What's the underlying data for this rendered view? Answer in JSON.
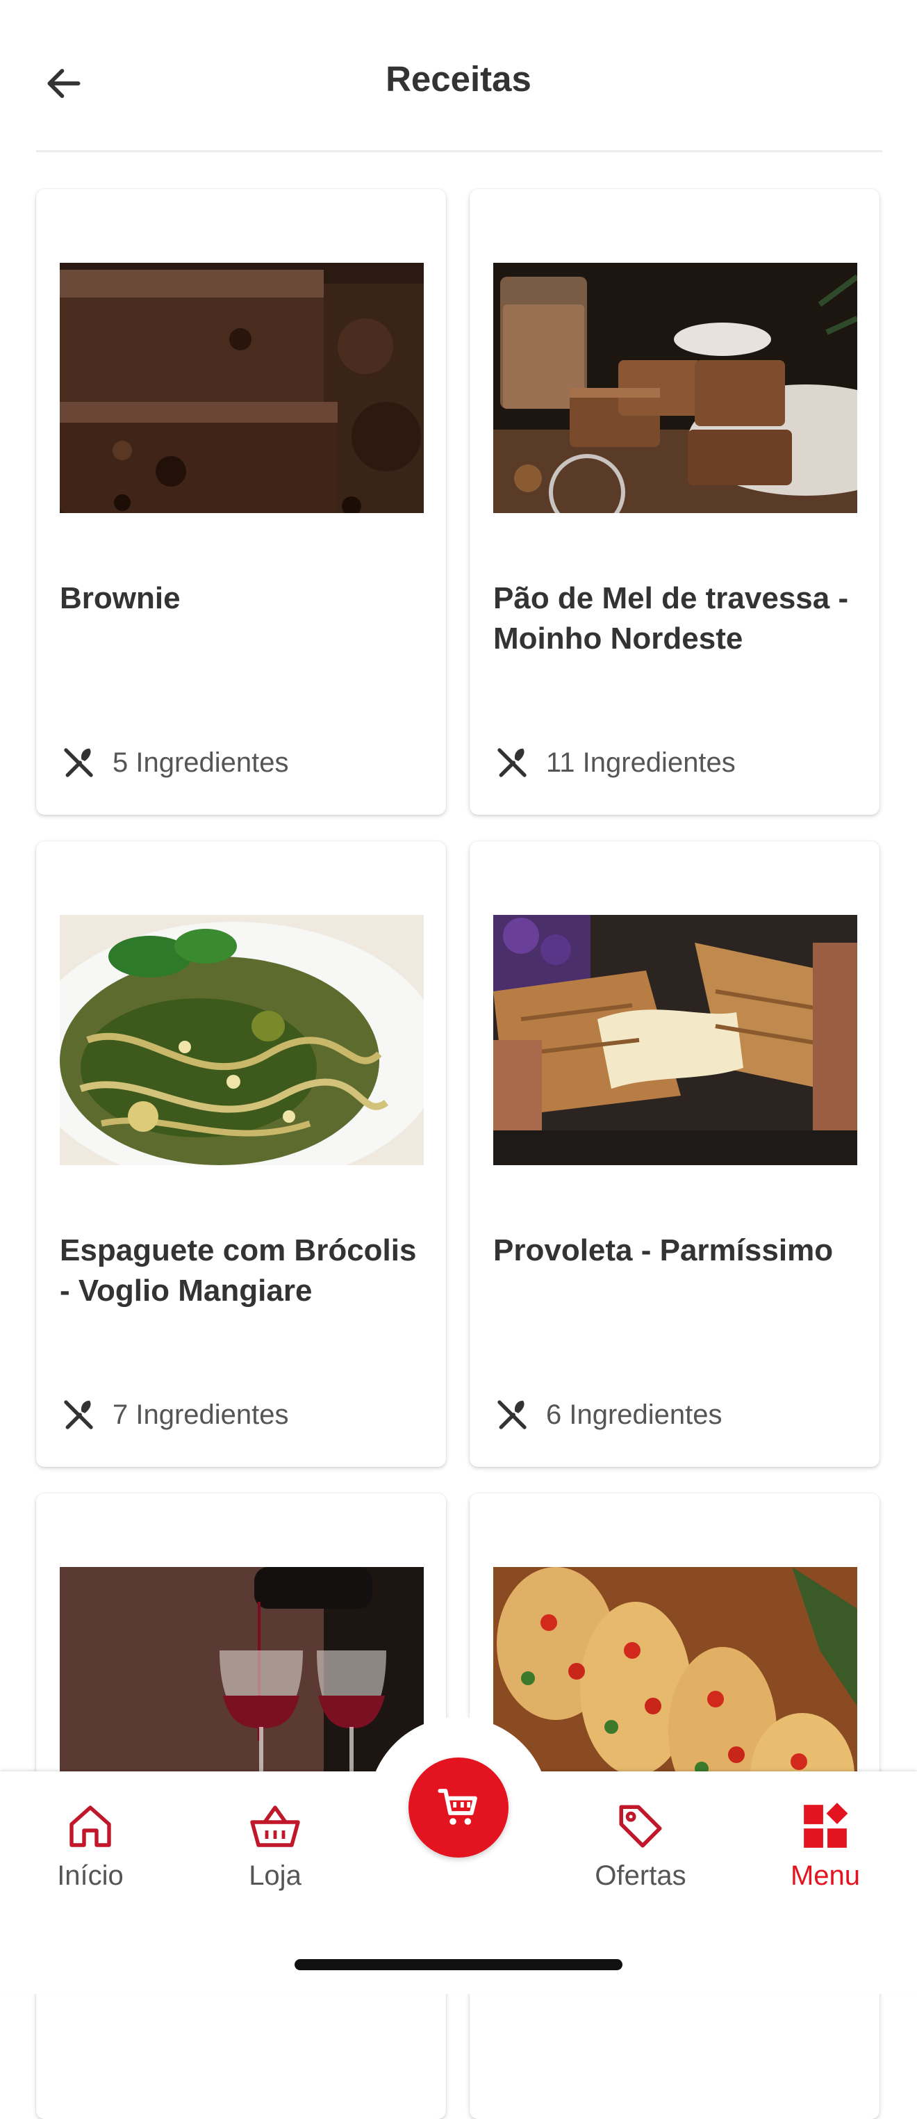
{
  "header": {
    "title": "Receitas",
    "back_icon": "arrow-left-icon"
  },
  "recipes": [
    {
      "title": "Brownie",
      "ingredients": "5 Ingredientes",
      "image": "brownie-photo"
    },
    {
      "title": "Pão de Mel de travessa - Moinho Nordeste",
      "ingredients": "11 Ingredientes",
      "image": "pao-de-mel-photo"
    },
    {
      "title": "Espaguete com Brócolis - Voglio Mangiare",
      "ingredients": "7 Ingredientes",
      "image": "spaghetti-photo"
    },
    {
      "title": "Provoleta - Parmíssimo",
      "ingredients": "6 Ingredientes",
      "image": "provoleta-photo"
    },
    {
      "title": "",
      "ingredients": "",
      "image": "wine-photo"
    },
    {
      "title": "",
      "ingredients": "",
      "image": "bruschetta-photo"
    }
  ],
  "nav": {
    "items": [
      {
        "label": "Início",
        "icon": "home-icon"
      },
      {
        "label": "Loja",
        "icon": "basket-icon"
      },
      {
        "label": "Ofertas",
        "icon": "tag-icon"
      },
      {
        "label": "Menu",
        "icon": "menu-grid-icon"
      }
    ],
    "cart_icon": "cart-icon",
    "active": "Menu"
  },
  "colors": {
    "accent": "#e3141f",
    "text": "#333333",
    "muted": "#555555",
    "background": "#ffffff"
  }
}
